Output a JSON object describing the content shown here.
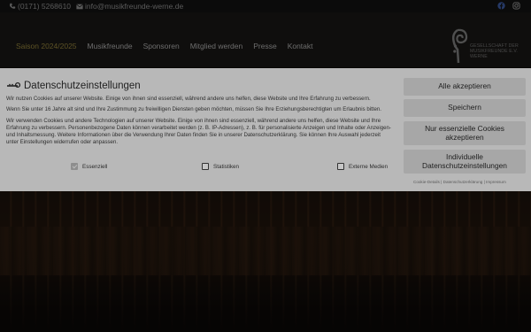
{
  "topbar": {
    "phone": "(0171) 5268610",
    "email": "info@musikfreunde-werne.de",
    "social": [
      "facebook-icon",
      "instagram-icon"
    ]
  },
  "nav": {
    "items": [
      {
        "label": "Saison 2024/2025",
        "active": true
      },
      {
        "label": "Musikfreunde",
        "active": false
      },
      {
        "label": "Sponsoren",
        "active": false
      },
      {
        "label": "Mitglied werden",
        "active": false
      },
      {
        "label": "Presse",
        "active": false
      },
      {
        "label": "Kontakt",
        "active": false
      }
    ],
    "logo_text": [
      "GESELLSCHAFT DER",
      "MUSIKFREUNDE E.V.",
      "WERNE"
    ]
  },
  "consent": {
    "title": "Datenschutzeinstellungen",
    "p1": "Wir nutzen Cookies auf unserer Website. Einige von ihnen sind essenziell, während andere uns helfen, diese Website und Ihre Erfahrung zu verbessern.",
    "p2": "Wenn Sie unter 16 Jahre alt sind und Ihre Zustimmung zu freiwilligen Diensten geben möchten, müssen Sie Ihre Erziehungsberechtigten um Erlaubnis bitten.",
    "p3": "Wir verwenden Cookies und andere Technologien auf unserer Website. Einige von ihnen sind essenziell, während andere uns helfen, diese Website und Ihre Erfahrung zu verbessern. Personenbezogene Daten können verarbeitet werden (z. B. IP-Adressen), z. B. für personalisierte Anzeigen und Inhalte oder Anzeigen- und Inhaltsmessung. Weitere Informationen über die Verwendung Ihrer Daten finden Sie in unserer Datenschutzerklärung. Sie können Ihre Auswahl jederzeit unter Einstellungen widerrufen oder anpassen.",
    "checks": [
      {
        "label": "Essenziell",
        "checked": true
      },
      {
        "label": "Statistiken",
        "checked": false
      },
      {
        "label": "Externe Medien",
        "checked": false
      }
    ],
    "buttons": {
      "accept_all": "Alle akzeptieren",
      "save": "Speichern",
      "essential_only": "Nur essenzielle Cookies akzeptieren",
      "individual": "Individuelle Datenschutzeinstellungen"
    },
    "links": {
      "cookie_details": "Cookie-Details",
      "privacy": "Datenschutzerklärung",
      "imprint": "Impressum",
      "sep": "|"
    }
  }
}
